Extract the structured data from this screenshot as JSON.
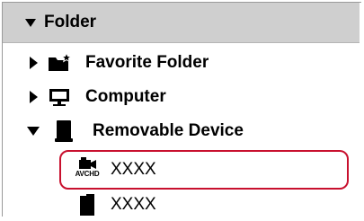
{
  "tree": {
    "header": {
      "label": "Folder",
      "expanded": true
    },
    "items": [
      {
        "label": "Favorite Folder",
        "icon": "favorite-folder-icon",
        "expanded": false
      },
      {
        "label": "Computer",
        "icon": "computer-icon",
        "expanded": false
      },
      {
        "label": "Removable Device",
        "icon": "removable-device-icon",
        "expanded": true,
        "children": [
          {
            "label": "XXXX",
            "icon": "avchd-camera-icon",
            "icon_caption": "AVCHD",
            "selected": true
          },
          {
            "label": "XXXX",
            "icon": "sd-card-icon",
            "selected": false
          }
        ]
      }
    ]
  },
  "colors": {
    "header_bg": "#cfcfcf",
    "selection_outline": "#c8102e"
  }
}
